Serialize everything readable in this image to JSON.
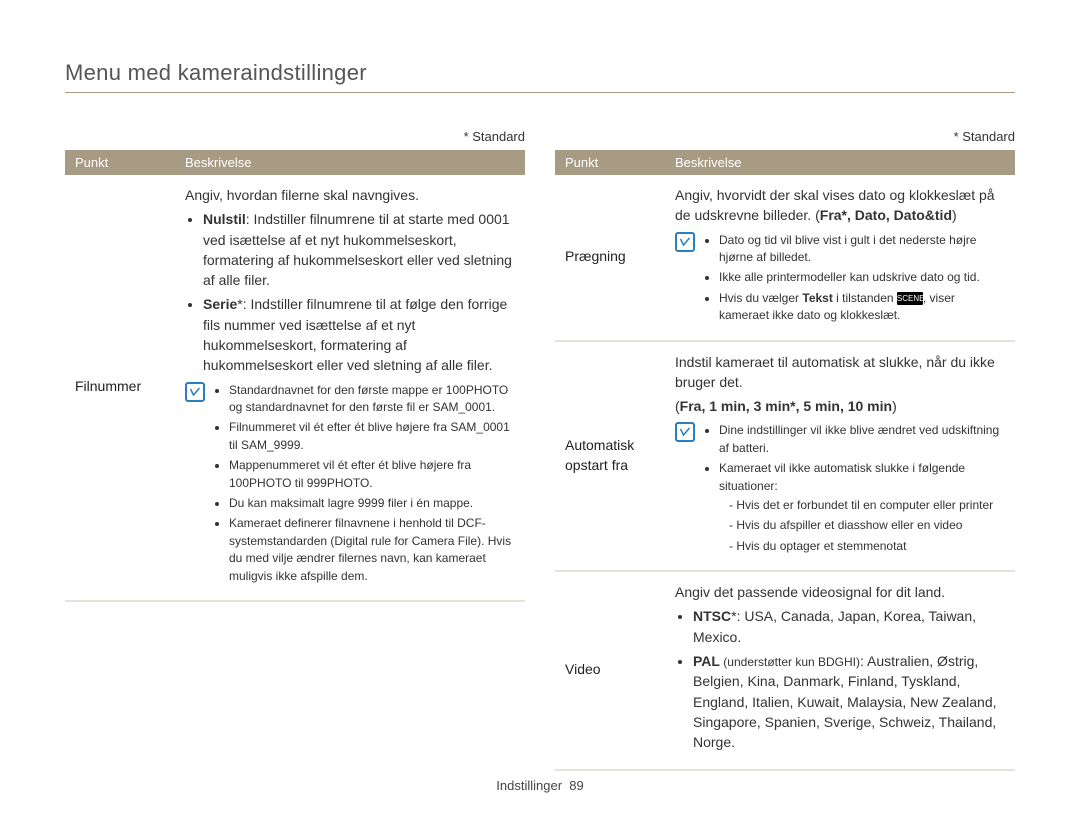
{
  "title": "Menu med kameraindstillinger",
  "standard_label": "* Standard",
  "headers": {
    "punkt": "Punkt",
    "beskrivelse": "Beskrivelse"
  },
  "footer": {
    "label": "Indstillinger",
    "page": "89"
  },
  "left": {
    "label": "Filnummer",
    "intro": "Angiv, hvordan filerne skal navngives.",
    "b1": {
      "lead_bold": "Nulstil",
      "lead_rest": ": Indstiller filnumrene til at starte med 0001 ved isættelse af et nyt hukommelseskort, formatering af hukommelseskort eller ved sletning af alle filer."
    },
    "b2": {
      "lead_bold": "Serie",
      "lead_rest": "*: Indstiller filnumrene til at følge den forrige fils nummer ved isættelse af et nyt hukommelseskort, formatering af hukommelseskort eller ved sletning af alle filer."
    },
    "note": {
      "n1": "Standardnavnet for den første mappe er 100PHOTO og standardnavnet for den første fil er SAM_0001.",
      "n2": "Filnummeret vil ét efter ét blive højere fra SAM_0001 til SAM_9999.",
      "n3": "Mappenummeret vil ét efter ét blive højere fra 100PHOTO til 999PHOTO.",
      "n4": "Du kan maksimalt lagre 9999 filer i én mappe.",
      "n5": "Kameraet definerer filnavnene i henhold til DCF-systemstandarden (Digital rule for Camera File). Hvis du med vilje ændrer filernes navn, kan kameraet muligvis ikke afspille dem."
    }
  },
  "right": {
    "row1": {
      "label": "Prægning",
      "intro": "Angiv, hvorvidt der skal vises dato og klokkeslæt på de udskrevne billeder. (",
      "options": "Fra*, Dato, Dato&tid",
      "intro_end": ")",
      "note": {
        "n1": "Dato og tid vil blive vist i gult i det nederste højre hjørne af billedet.",
        "n2": "Ikke alle printermodeller kan udskrive dato og tid.",
        "n3a": "Hvis du vælger ",
        "n3b": "Tekst",
        "n3c": " i tilstanden ",
        "n3d": ", viser kameraet ikke dato og klokkeslæt."
      }
    },
    "row2": {
      "label_l1": "Automatisk",
      "label_l2": "opstart fra",
      "intro": "Indstil kameraet til automatisk at slukke, når du ikke bruger det.",
      "options": "Fra, 1 min, 3 min*, 5 min, 10 min",
      "note": {
        "n1": "Dine indstillinger vil ikke blive ændret ved udskiftning af batteri.",
        "n2": "Kameraet vil ikke automatisk slukke i følgende situationer:",
        "s1": "Hvis det er forbundet til en computer eller printer",
        "s2": "Hvis du afspiller et diasshow eller en video",
        "s3": "Hvis du optager et stemmenotat"
      }
    },
    "row3": {
      "label": "Video",
      "intro": "Angiv det passende videosignal for dit land.",
      "b1": {
        "lead_bold": "NTSC",
        "lead_rest": "*: USA, Canada, Japan, Korea, Taiwan, Mexico."
      },
      "b2": {
        "lead_bold": "PAL",
        "lead_paren": " (understøtter kun BDGHI)",
        "lead_rest": ": Australien, Østrig, Belgien, Kina, Danmark, Finland, Tyskland, England, Italien, Kuwait, Malaysia, New Zealand, Singapore, Spanien, Sverige, Schweiz, Thailand, Norge."
      }
    }
  }
}
